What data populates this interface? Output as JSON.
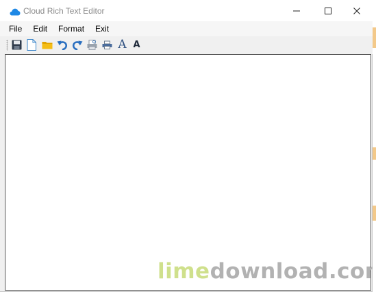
{
  "window": {
    "title": "Cloud Rich Text Editor",
    "icon": "cloud-icon",
    "controls": [
      "minimize-icon",
      "maximize-icon",
      "close-icon"
    ]
  },
  "menu": {
    "items": [
      {
        "label": "File"
      },
      {
        "label": "Edit"
      },
      {
        "label": "Format"
      },
      {
        "label": "Exit"
      }
    ]
  },
  "toolbar": {
    "buttons": [
      {
        "icon": "save-icon"
      },
      {
        "icon": "new-document-icon"
      },
      {
        "icon": "open-folder-icon"
      },
      {
        "icon": "undo-icon"
      },
      {
        "icon": "redo-icon"
      },
      {
        "icon": "print-preview-icon"
      },
      {
        "icon": "print-icon"
      },
      {
        "icon": "font-icon",
        "glyph": "A"
      },
      {
        "icon": "font-bold-icon",
        "glyph": "A"
      }
    ]
  },
  "editor": {
    "content": ""
  },
  "watermark": {
    "part1": "lime",
    "part2": "download.com"
  },
  "colors": {
    "accent": "#1e88e5",
    "watermark_green": "#cfe08c",
    "watermark_gray": "#b2b2b2"
  }
}
